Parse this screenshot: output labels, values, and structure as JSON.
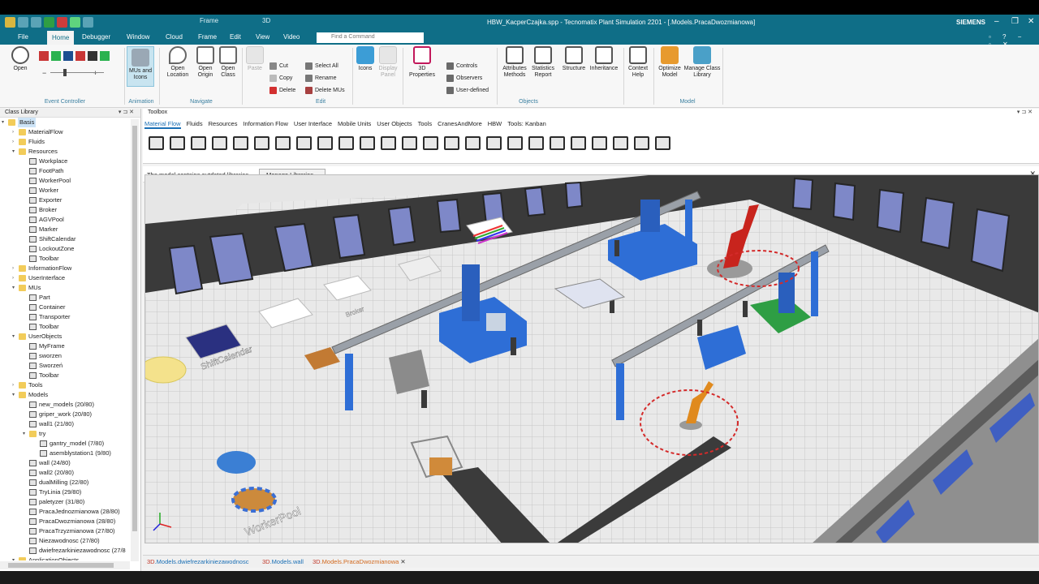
{
  "window": {
    "title": "HBW_KacperCzajka.spp - Tecnomatix Plant Simulation 2201 - [.Models.PracaDwozmianowa]",
    "brand": "SIEMENS",
    "context_tabs": [
      "Frame",
      "3D"
    ]
  },
  "menu": {
    "items": [
      "File",
      "Home",
      "Debugger",
      "Window",
      "Cloud",
      "Frame",
      "Edit",
      "View",
      "Video"
    ],
    "active": "Home",
    "find_placeholder": "Find a Command"
  },
  "ribbon": {
    "open": "Open",
    "event_controller": "Event Controller",
    "mus_icons": "MUs and Icons",
    "animation": "Animation",
    "open_location": "Open Location",
    "open_origin": "Open Origin",
    "open_class": "Open Class",
    "navigate": "Navigate",
    "paste": "Paste",
    "cut": "Cut",
    "copy": "Copy",
    "delete": "Delete",
    "select_all": "Select All",
    "rename": "Rename",
    "delete_mus": "Delete MUs",
    "edit": "Edit",
    "icons": "Icons",
    "display_panel": "Display Panel",
    "properties_3d": "3D Properties",
    "controls": "Controls",
    "observers": "Observers",
    "user_defined": "User-defined",
    "attributes_methods": "Attributes Methods",
    "statistics_report": "Statistics Report",
    "objects": "Objects",
    "structure": "Structure",
    "inheritance": "Inheritance",
    "context_help": "Context Help",
    "optimize_model": "Optimize Model",
    "manage_class_library": "Manage Class Library",
    "model": "Model"
  },
  "class_library": {
    "title": "Class Library",
    "items": [
      {
        "label": "Basis",
        "level": 0,
        "expander": "▾",
        "type": "folder",
        "selected": true
      },
      {
        "label": "MaterialFlow",
        "level": 1,
        "expander": "›",
        "type": "folder"
      },
      {
        "label": "Fluids",
        "level": 1,
        "expander": "›",
        "type": "folder"
      },
      {
        "label": "Resources",
        "level": 1,
        "expander": "▾",
        "type": "folder"
      },
      {
        "label": "Workplace",
        "level": 2,
        "type": "obj"
      },
      {
        "label": "FootPath",
        "level": 2,
        "type": "obj"
      },
      {
        "label": "WorkerPool",
        "level": 2,
        "type": "obj"
      },
      {
        "label": "Worker",
        "level": 2,
        "type": "obj"
      },
      {
        "label": "Exporter",
        "level": 2,
        "type": "obj"
      },
      {
        "label": "Broker",
        "level": 2,
        "type": "obj"
      },
      {
        "label": "AGVPool",
        "level": 2,
        "type": "obj"
      },
      {
        "label": "Marker",
        "level": 2,
        "type": "obj"
      },
      {
        "label": "ShiftCalendar",
        "level": 2,
        "type": "obj"
      },
      {
        "label": "LockoutZone",
        "level": 2,
        "type": "obj"
      },
      {
        "label": "Toolbar",
        "level": 2,
        "type": "obj"
      },
      {
        "label": "InformationFlow",
        "level": 1,
        "expander": "›",
        "type": "folder"
      },
      {
        "label": "UserInterface",
        "level": 1,
        "expander": "›",
        "type": "folder"
      },
      {
        "label": "MUs",
        "level": 1,
        "expander": "▾",
        "type": "folder"
      },
      {
        "label": "Part",
        "level": 2,
        "type": "obj"
      },
      {
        "label": "Container",
        "level": 2,
        "type": "obj"
      },
      {
        "label": "Transporter",
        "level": 2,
        "type": "obj"
      },
      {
        "label": "Toolbar",
        "level": 2,
        "type": "obj"
      },
      {
        "label": "UserObjects",
        "level": 1,
        "expander": "▾",
        "type": "folder"
      },
      {
        "label": "MyFrame",
        "level": 2,
        "type": "obj"
      },
      {
        "label": "sworzen",
        "level": 2,
        "type": "obj"
      },
      {
        "label": "Sworzeń",
        "level": 2,
        "type": "obj"
      },
      {
        "label": "Toolbar",
        "level": 2,
        "type": "obj"
      },
      {
        "label": "Tools",
        "level": 1,
        "expander": "›",
        "type": "folder"
      },
      {
        "label": "Models",
        "level": 1,
        "expander": "▾",
        "type": "folder"
      },
      {
        "label": "new_models (20/80)",
        "level": 2,
        "type": "obj"
      },
      {
        "label": "griper_work (20/80)",
        "level": 2,
        "type": "obj"
      },
      {
        "label": "wall1 (21/80)",
        "level": 2,
        "type": "obj"
      },
      {
        "label": "try",
        "level": 2,
        "expander": "▾",
        "type": "folder"
      },
      {
        "label": "gantry_model (7/80)",
        "level": 3,
        "type": "obj"
      },
      {
        "label": "asemblystation1 (9/80)",
        "level": 3,
        "type": "obj"
      },
      {
        "label": "wall (24/80)",
        "level": 2,
        "type": "obj"
      },
      {
        "label": "wall2 (20/80)",
        "level": 2,
        "type": "obj"
      },
      {
        "label": "dualMilling (22/80)",
        "level": 2,
        "type": "obj"
      },
      {
        "label": "TryLinia (29/80)",
        "level": 2,
        "type": "obj"
      },
      {
        "label": "paletyzer (31/80)",
        "level": 2,
        "type": "obj"
      },
      {
        "label": "PracaJednozmianowa (28/80)",
        "level": 2,
        "type": "obj"
      },
      {
        "label": "PracaDwozmianowa (28/80)",
        "level": 2,
        "type": "obj"
      },
      {
        "label": "PracaTrzyzmianowa (27/80)",
        "level": 2,
        "type": "obj"
      },
      {
        "label": "Niezawodnosc (27/80)",
        "level": 2,
        "type": "obj"
      },
      {
        "label": "dwiefrezarkiniezawodnosc (27/8",
        "level": 2,
        "type": "obj"
      },
      {
        "label": "ApplicationObjects",
        "level": 1,
        "expander": "▾",
        "type": "folder"
      }
    ]
  },
  "toolbox": {
    "title": "Toolbox",
    "tabs": [
      "Material Flow",
      "Fluids",
      "Resources",
      "Information Flow",
      "User Interface",
      "Mobile Units",
      "User Objects",
      "Tools",
      "CranesAndMore",
      "HBW",
      "Tools: Kanban"
    ],
    "active_tab": "Material Flow"
  },
  "notice": {
    "text": "The model contains outdated libraries.",
    "button": "Manage Libraries..."
  },
  "scene": {
    "labels": [
      "ShiftCalendar",
      "WorkerPool",
      "Broker"
    ]
  },
  "doc_tabs": [
    {
      "prefix": "3D",
      "label": ".Models.dwiefrezarkiniezawodnosc",
      "active": false
    },
    {
      "prefix": "3D",
      "label": ".Models.wall",
      "active": false
    },
    {
      "prefix": "3D",
      "label": ".Models.PracaDwozmianowa",
      "active": true
    }
  ],
  "colors": {
    "accent": "#0f6e87",
    "machine_blue": "#2e6ed6",
    "robot_orange": "#e08a1e",
    "robot_red": "#c8241d"
  }
}
